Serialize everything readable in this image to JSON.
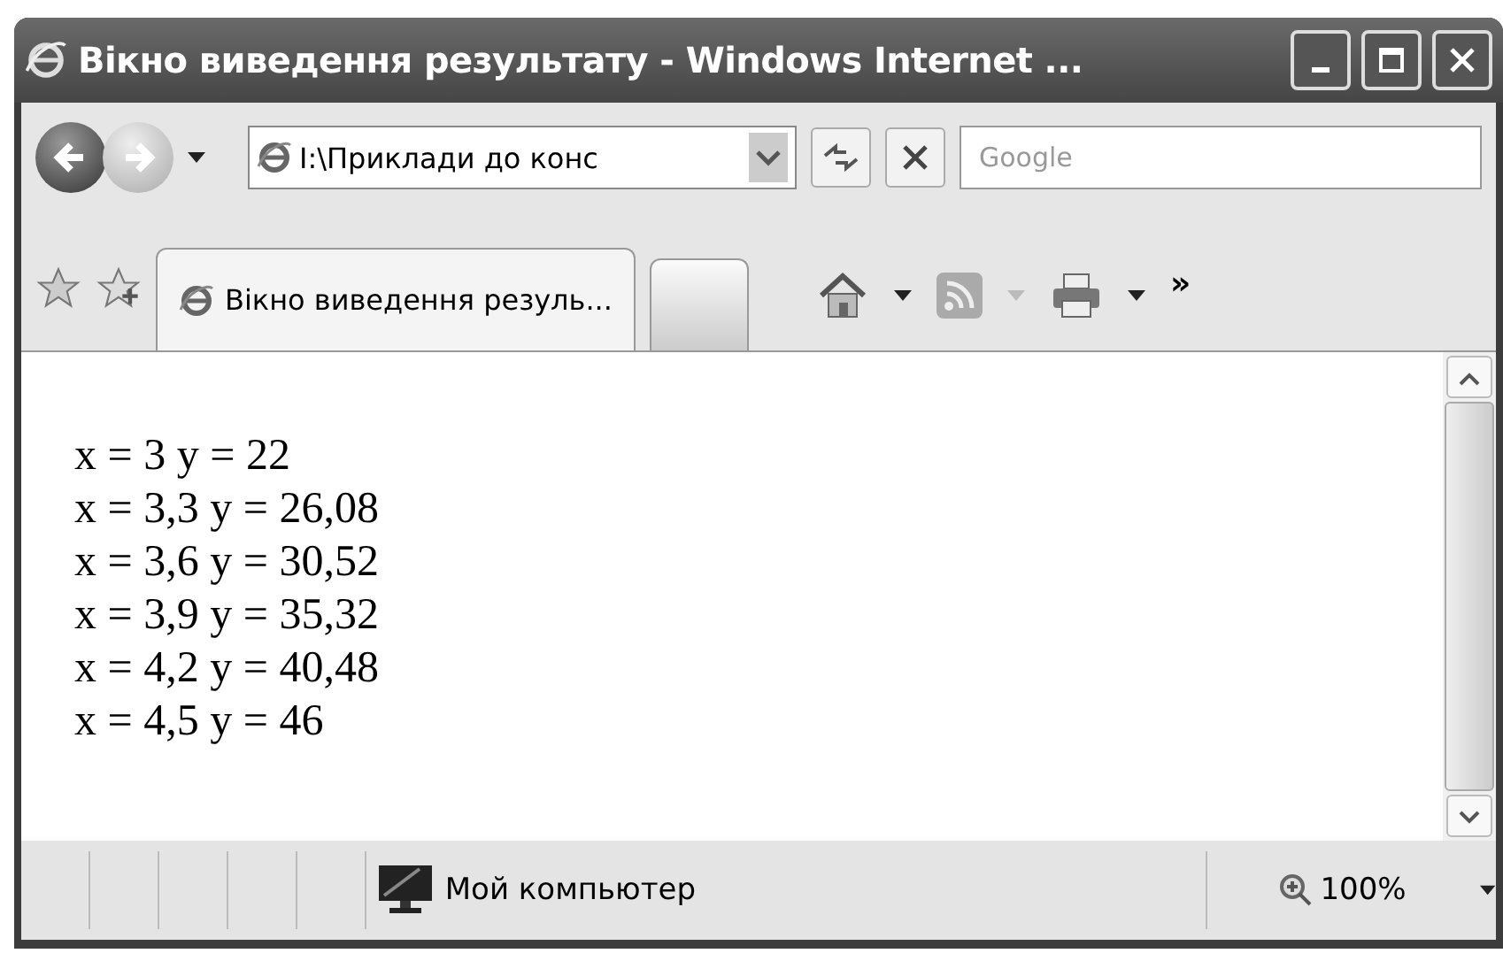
{
  "window": {
    "title": "Вікно виведення результату - Windows Internet ..."
  },
  "navigation": {
    "address": "I:\\Приклади до конс",
    "search_placeholder": "Google"
  },
  "tabs": [
    {
      "label": "Вікно виведення резуль...",
      "selected": true
    }
  ],
  "toolbar": {
    "more": "»"
  },
  "content": {
    "lines": [
      "x = 3 y = 22",
      "x = 3,3 y = 26,08",
      "x = 3,6 y = 30,52",
      "x = 3,9 y = 35,32",
      "x = 4,2 y = 40,48",
      "x = 4,5 y = 46"
    ]
  },
  "status_bar": {
    "zone": "Мой компьютер",
    "zoom": "100%"
  }
}
